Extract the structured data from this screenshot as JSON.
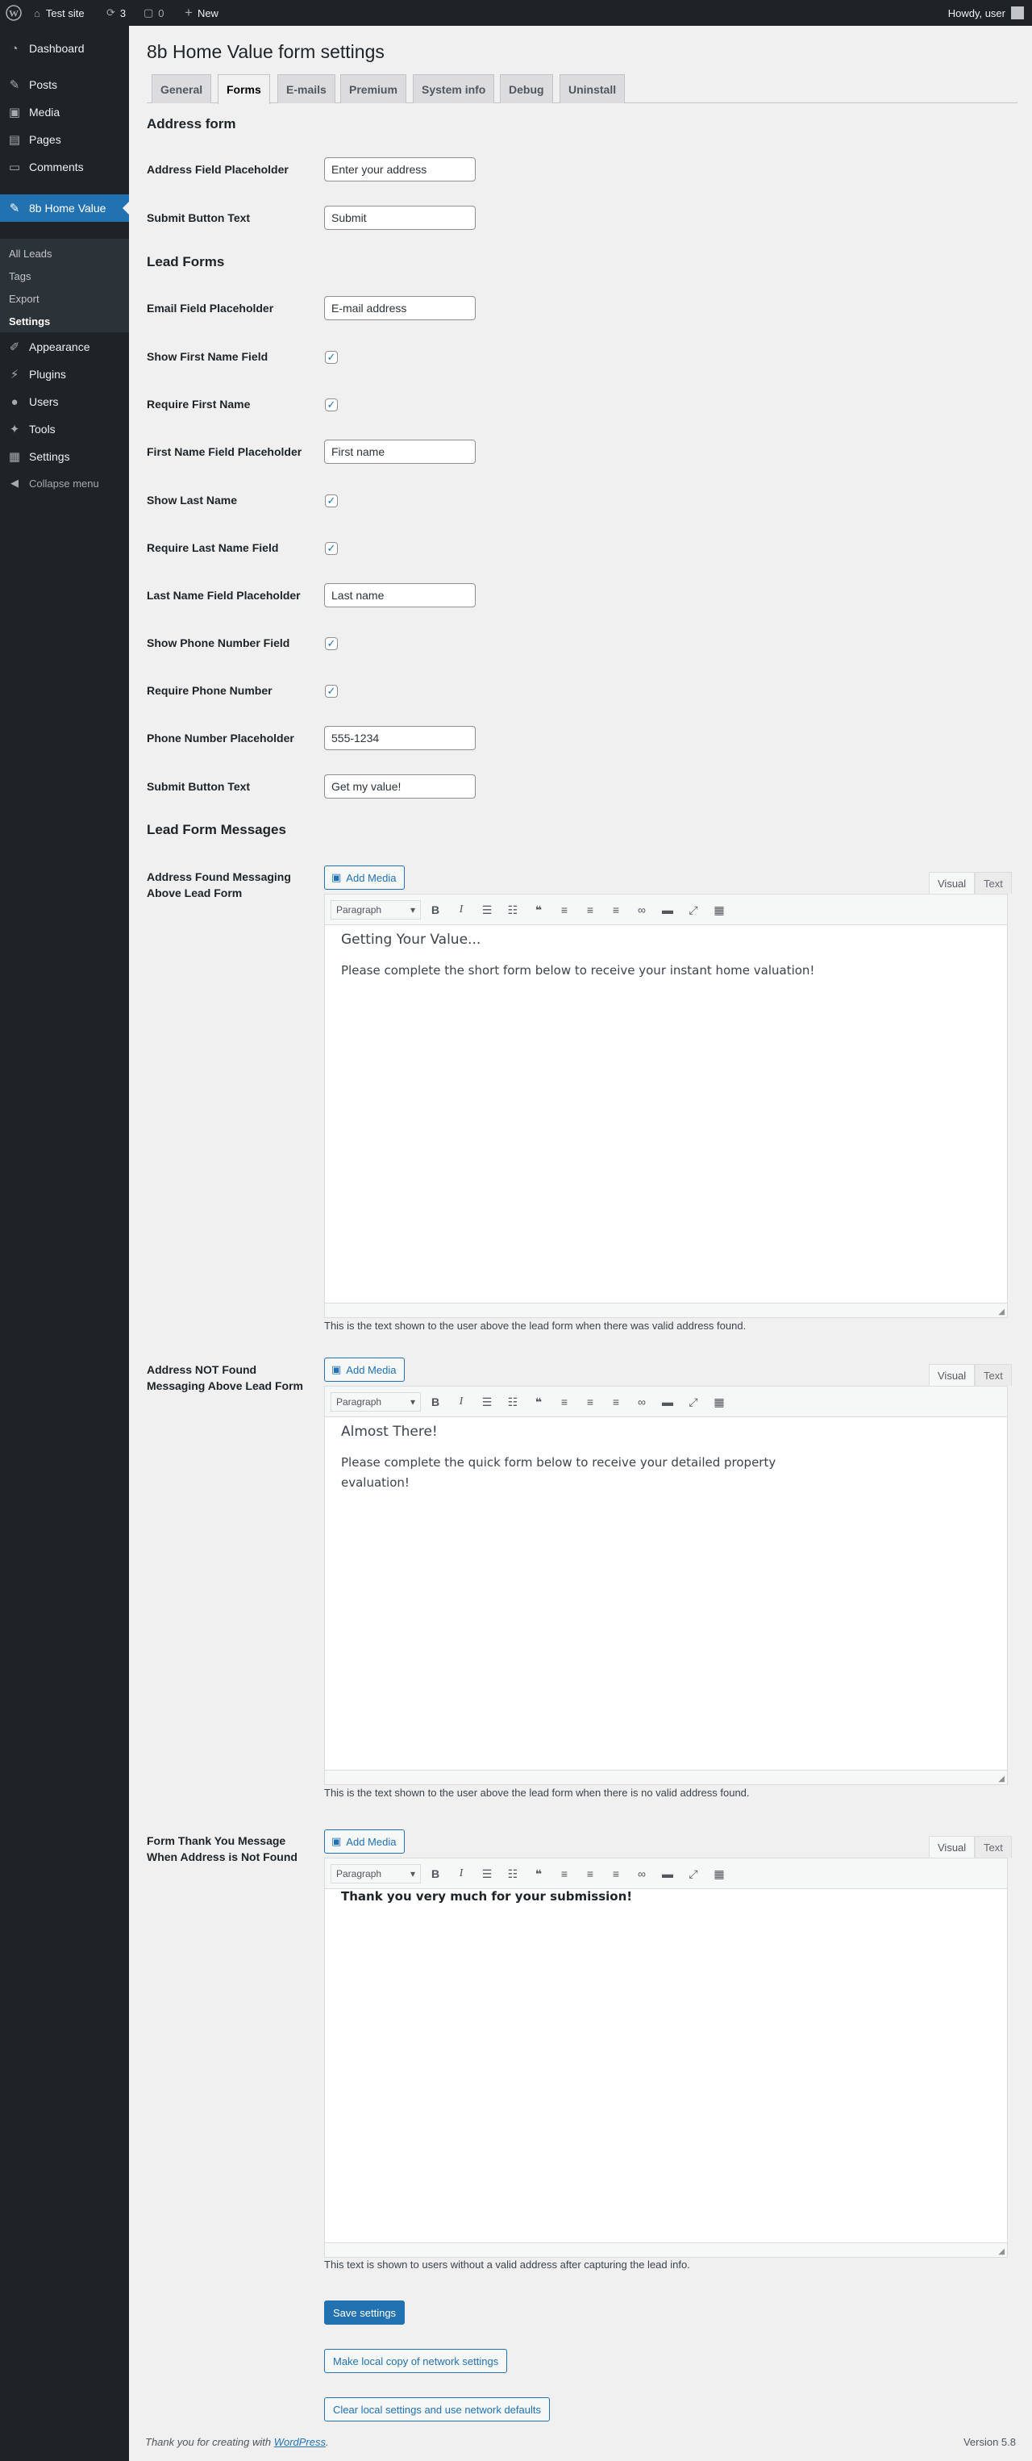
{
  "adminbar": {
    "site_name": "Test site",
    "updates_count": "3",
    "comments_count": "0",
    "new_label": "New",
    "howdy": "Howdy, user"
  },
  "sidebar": {
    "items": [
      {
        "label": "Dashboard",
        "icon": "dashboard-icon"
      },
      {
        "label": "Posts",
        "icon": "pin-icon"
      },
      {
        "label": "Media",
        "icon": "media-icon"
      },
      {
        "label": "Pages",
        "icon": "pages-icon"
      },
      {
        "label": "Comments",
        "icon": "comments-icon"
      },
      {
        "label": "8b Home Value",
        "icon": "pin-icon"
      },
      {
        "label": "Appearance",
        "icon": "brush-icon"
      },
      {
        "label": "Plugins",
        "icon": "plugin-icon"
      },
      {
        "label": "Users",
        "icon": "users-icon"
      },
      {
        "label": "Tools",
        "icon": "wrench-icon"
      },
      {
        "label": "Settings",
        "icon": "settings-icon"
      }
    ],
    "submenu": [
      "All Leads",
      "Tags",
      "Export",
      "Settings"
    ],
    "collapse_label": "Collapse menu"
  },
  "page": {
    "title": "8b Home Value form settings",
    "tabs": [
      "General",
      "Forms",
      "E-mails",
      "Premium",
      "System info",
      "Debug",
      "Uninstall"
    ]
  },
  "address_form": {
    "title": "Address form",
    "placeholder_label": "Address Field Placeholder",
    "placeholder_value": "Enter your address",
    "submit_label": "Submit Button Text",
    "submit_value": "Submit"
  },
  "lead_forms": {
    "title": "Lead Forms",
    "email_label": "Email Field Placeholder",
    "email_value": "E-mail address",
    "show_first_label": "Show First Name Field",
    "require_first_label": "Require First Name",
    "first_placeholder_label": "First Name Field Placeholder",
    "first_placeholder_value": "First name",
    "show_last_label": "Show Last Name",
    "require_last_label": "Require Last Name Field",
    "last_placeholder_label": "Last Name Field Placeholder",
    "last_placeholder_value": "Last name",
    "show_phone_label": "Show Phone Number Field",
    "require_phone_label": "Require Phone Number",
    "phone_placeholder_label": "Phone Number Placeholder",
    "phone_placeholder_value": "555-1234",
    "submit_label": "Submit Button Text",
    "submit_value": "Get my value!",
    "checkmark": "✓"
  },
  "messages": {
    "title": "Lead Form Messages",
    "add_media": "Add Media",
    "visual_tab": "Visual",
    "text_tab": "Text",
    "format_select": "Paragraph",
    "found": {
      "label": "Address Found Messaging Above Lead Form",
      "heading": "Getting Your Value...",
      "body": "Please complete the short form below to receive your instant home valuation!",
      "desc": "This is the text shown to the user above the lead form when there was valid address found."
    },
    "not_found": {
      "label": "Address NOT Found Messaging Above Lead Form",
      "heading": "Almost There!",
      "body": "Please complete the quick form below to receive your detailed property evaluation!",
      "desc": "This is the text shown to the user above the lead form when there is no valid address found."
    },
    "thank_you": {
      "label": "Form Thank You Message When Address is Not Found",
      "body": "Thank you very much for your submission!",
      "desc": "This text is shown to users without a valid address after capturing the lead info."
    }
  },
  "buttons": {
    "save": "Save settings",
    "copy_network": "Make local copy of network settings",
    "clear_local": "Clear local settings and use network defaults"
  },
  "footer": {
    "thanks_prefix": "Thank you for creating with ",
    "thanks_link": "WordPress",
    "thanks_suffix": ".",
    "version": "Version 5.8"
  }
}
